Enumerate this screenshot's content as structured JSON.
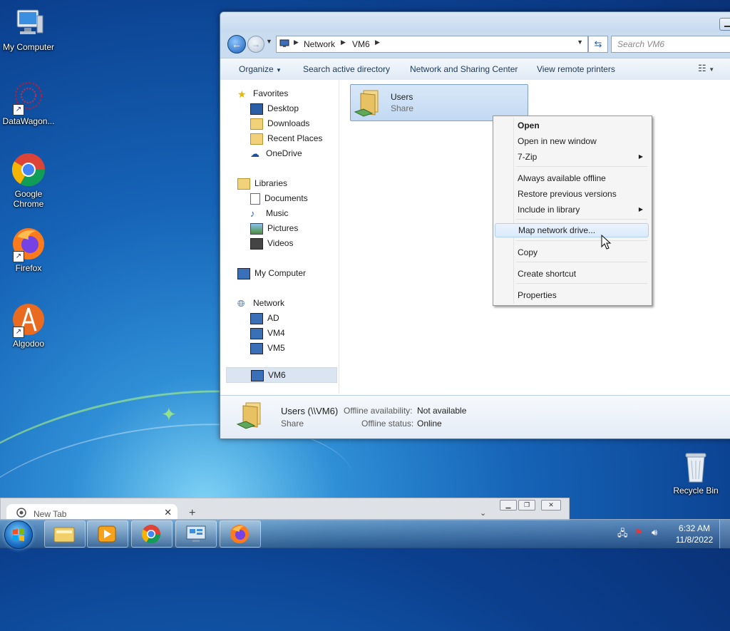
{
  "desktop": {
    "icons": [
      {
        "label": "My Computer"
      },
      {
        "label": "DataWagon..."
      },
      {
        "label": "Google Chrome"
      },
      {
        "label": "Firefox"
      },
      {
        "label": "Algodoo"
      },
      {
        "label": "Recycle Bin"
      }
    ]
  },
  "explorer": {
    "breadcrumb": [
      "Network",
      "VM6"
    ],
    "search_placeholder": "Search VM6",
    "toolbar": {
      "organize": "Organize",
      "search_ad": "Search active directory",
      "network_center": "Network and Sharing Center",
      "remote_printers": "View remote printers"
    },
    "nav": {
      "favorites": "Favorites",
      "desktop": "Desktop",
      "downloads": "Downloads",
      "recent": "Recent Places",
      "onedrive": "OneDrive",
      "libraries": "Libraries",
      "documents": "Documents",
      "music": "Music",
      "pictures": "Pictures",
      "videos": "Videos",
      "mycomputer": "My Computer",
      "network": "Network",
      "ad": "AD",
      "vm4": "VM4",
      "vm5": "VM5",
      "vm6": "VM6"
    },
    "item": {
      "name": "Users",
      "type": "Share"
    },
    "details": {
      "title": "Users (\\\\VM6)",
      "type": "Share",
      "offline_label": "Offline availability:",
      "offline_value": "Not available",
      "status_label": "Offline status:",
      "status_value": "Online"
    }
  },
  "context_menu": {
    "open": "Open",
    "open_new": "Open in new window",
    "zip": "7-Zip",
    "always_offline": "Always available offline",
    "restore": "Restore previous versions",
    "include_lib": "Include in library",
    "map_drive": "Map network drive...",
    "copy": "Copy",
    "shortcut": "Create shortcut",
    "properties": "Properties"
  },
  "chrome": {
    "tab_title": "New Tab"
  },
  "taskbar": {
    "time": "6:32 AM",
    "date": "11/8/2022"
  }
}
